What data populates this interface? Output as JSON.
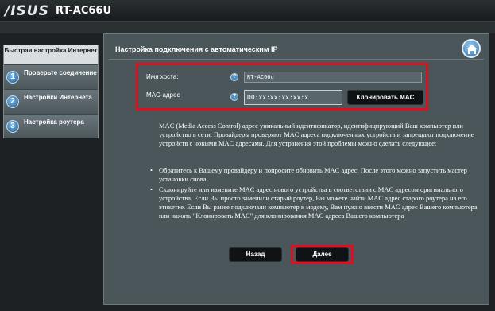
{
  "header": {
    "brand": "/ISUS",
    "model": "RT-AC66U"
  },
  "sidebar": {
    "heading": "Быстрая настройка Интернет",
    "steps": [
      {
        "num": "1",
        "label": "Проверьте соединение"
      },
      {
        "num": "2",
        "label": "Настройки Интернета"
      },
      {
        "num": "3",
        "label": "Настройка роутера"
      }
    ]
  },
  "main": {
    "title": "Настройка подключения с автоматическим IP",
    "form": {
      "host_label": "Имя хоста:",
      "host_value": "RT-AC66u",
      "mac_label": "MAC-адрес",
      "mac_value": "D0:xx:xx:xx:xx:x",
      "clone_button": "Клонировать MAC",
      "help_glyph": "?"
    },
    "description": "MAC (Media Access Control) адрес уникальный идентификатор, идентифицирующий Ваш компьютер или устройство в сети. Провайдеры проверяют MAC адреса подключенных устройств и запрещают подключение устройств с новыми MAC адресами. Для устранения этой проблемы можно сделать следующее:",
    "bullets": [
      "Обратитесь к Вашему провайдеру и попросите обновить MAC адрес. После этого можно запустить мастер установки снова",
      "Склонируйте или измените MAC адрес нового устройства в соответствии с MAC адресом оригинального устройства. Если Вы просто заменили старый роутер, Вы можете найти MAC адрес старого роутера на его этикетке. Если Вы ранее подключали компьютер к модему, Вам нужно ввести MAC адрес Вашего компьютера или нажать \"Клонировать MAC\" для клонирования MAC адреса Вашего компьютера"
    ],
    "back_button": "Назад",
    "next_button": "Далее"
  },
  "colors": {
    "highlight": "#e10e1e",
    "panel": "#4b565a",
    "accent": "#4d90c2"
  }
}
